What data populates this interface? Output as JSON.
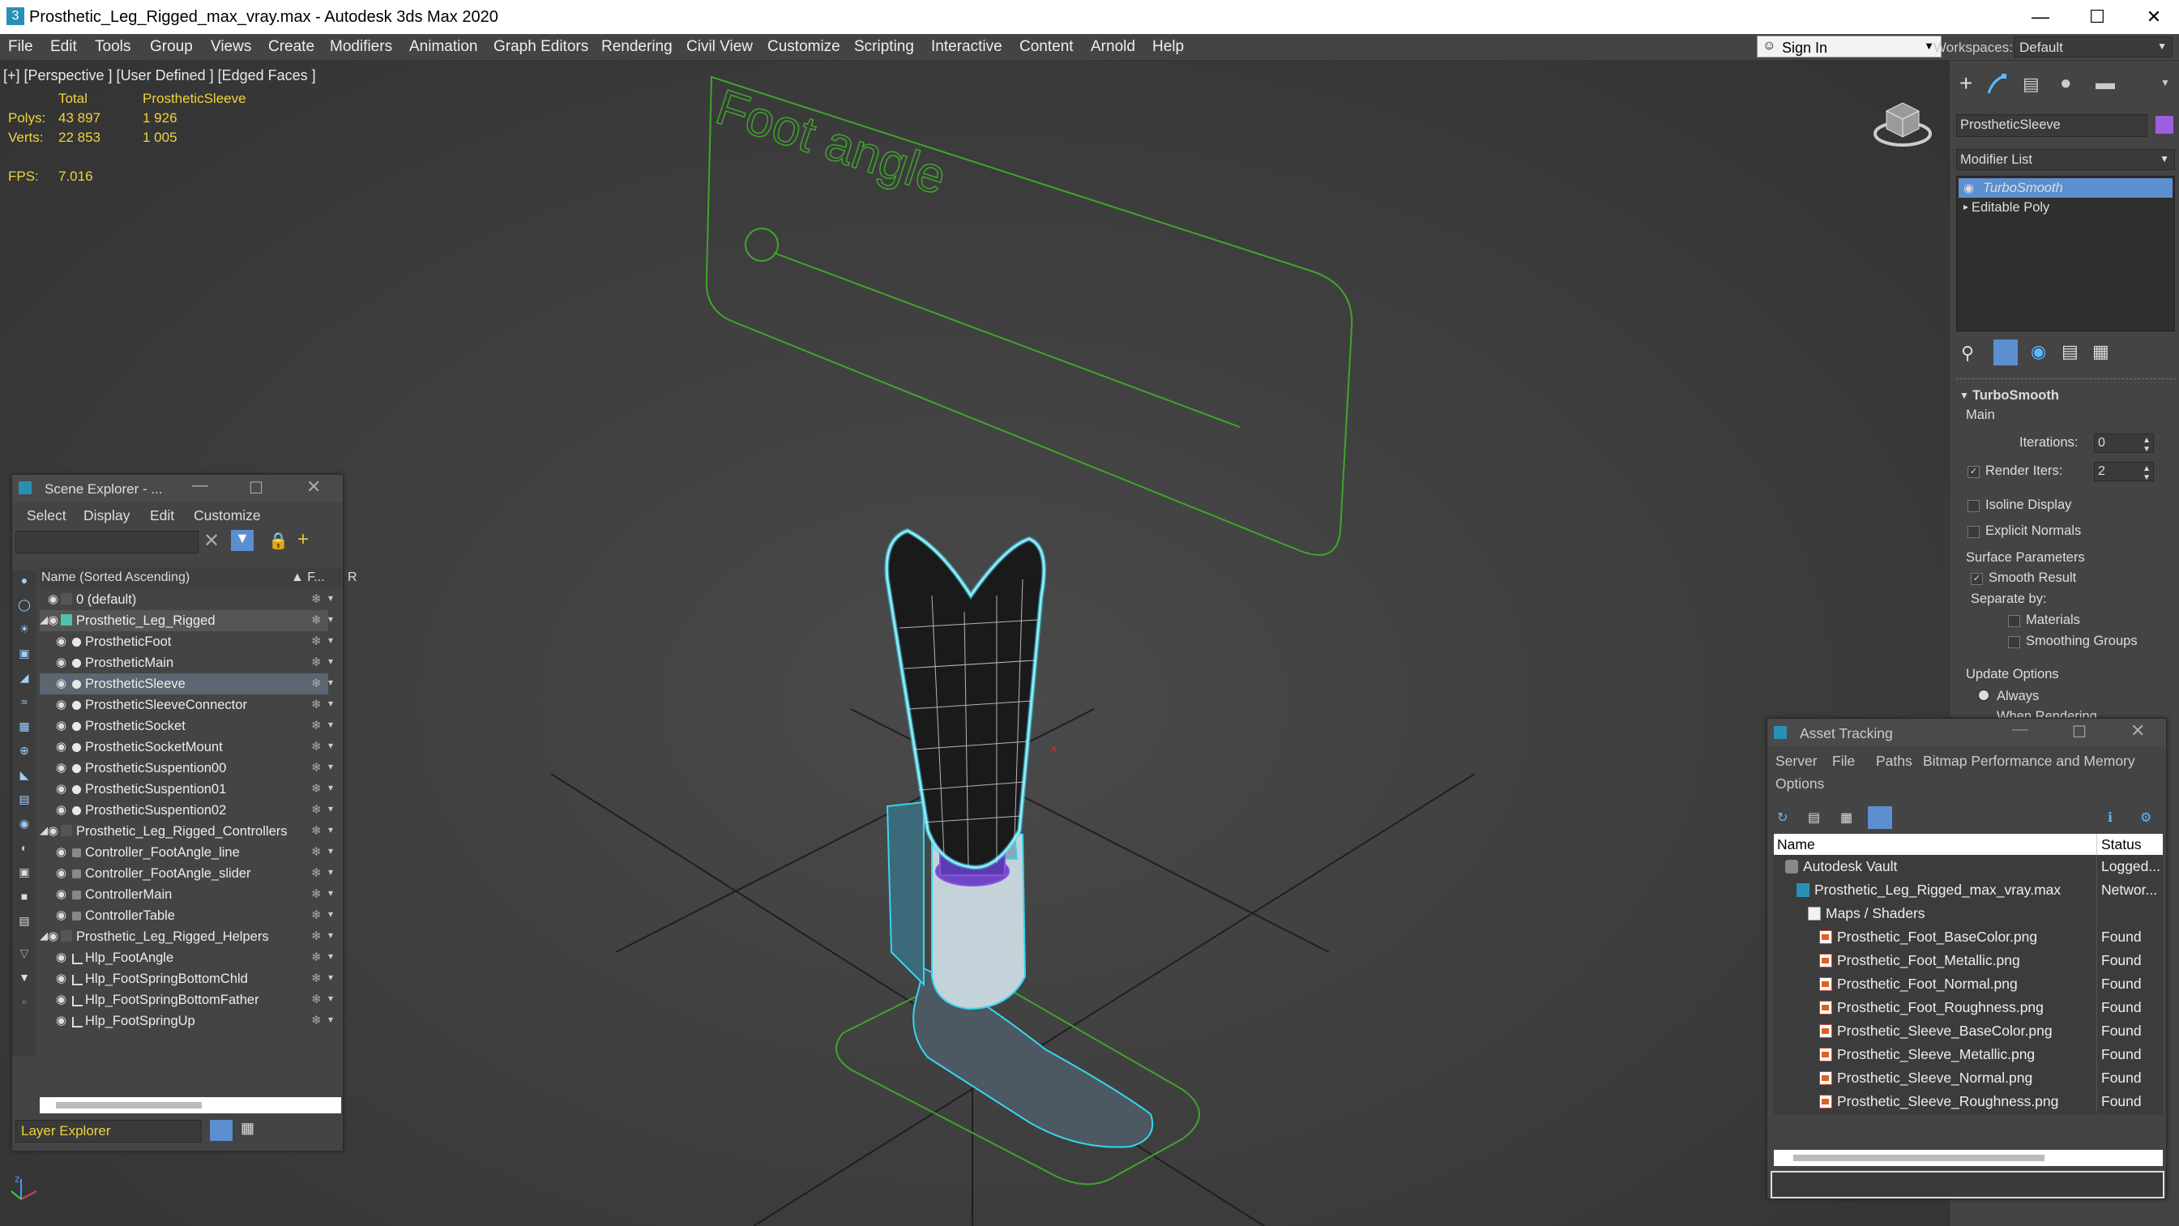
{
  "window": {
    "title": "Prosthetic_Leg_Rigged_max_vray.max - Autodesk 3ds Max 2020",
    "app_icon": "3",
    "minimize_glyph": "—",
    "maximize_glyph": "☐",
    "close_glyph": "✕"
  },
  "menubar": {
    "items": [
      "File",
      "Edit",
      "Tools",
      "Group",
      "Views",
      "Create",
      "Modifiers",
      "Animation",
      "Graph Editors",
      "Rendering",
      "Civil View",
      "Customize",
      "Scripting",
      "Interactive",
      "Content",
      "Arnold",
      "Help"
    ],
    "signin_label": "Sign In",
    "workspaces_label": "Workspaces:",
    "workspace_value": "Default"
  },
  "viewport": {
    "label": "[+] [Perspective ] [User Defined ] [Edged Faces ]",
    "stats": {
      "col_total": "Total",
      "col_object": "ProstheticSleeve",
      "polys_label": "Polys:",
      "polys_total": "43 897",
      "polys_object": "1 926",
      "verts_label": "Verts:",
      "verts_total": "22 853",
      "verts_object": "1 005",
      "fps_label": "FPS:",
      "fps_value": "7.016"
    },
    "controller_text": "Foot angle",
    "axis_x": "x",
    "axis_z": "z"
  },
  "scene_explorer": {
    "title": "Scene Explorer - ...",
    "menu": [
      "Select",
      "Display",
      "Edit",
      "Customize"
    ],
    "column_name": "Name (Sorted Ascending)",
    "column_freeze": "▲ F...",
    "column_render": "R",
    "rows": [
      {
        "label": "0 (default)",
        "indent": 0
      },
      {
        "label": "Prosthetic_Leg_Rigged",
        "indent": 0
      },
      {
        "label": "ProstheticFoot",
        "indent": 1
      },
      {
        "label": "ProstheticMain",
        "indent": 1
      },
      {
        "label": "ProstheticSleeve",
        "indent": 1
      },
      {
        "label": "ProstheticSleeveConnector",
        "indent": 1
      },
      {
        "label": "ProstheticSocket",
        "indent": 1
      },
      {
        "label": "ProstheticSocketMount",
        "indent": 1
      },
      {
        "label": "ProstheticSuspention00",
        "indent": 1
      },
      {
        "label": "ProstheticSuspention01",
        "indent": 1
      },
      {
        "label": "ProstheticSuspention02",
        "indent": 1
      },
      {
        "label": "Prosthetic_Leg_Rigged_Controllers",
        "indent": 0
      },
      {
        "label": "Controller_FootAngle_line",
        "indent": 1
      },
      {
        "label": "Controller_FootAngle_slider",
        "indent": 1
      },
      {
        "label": "ControllerMain",
        "indent": 1
      },
      {
        "label": "ControllerTable",
        "indent": 1
      },
      {
        "label": "Prosthetic_Leg_Rigged_Helpers",
        "indent": 0
      },
      {
        "label": "Hlp_FootAngle",
        "indent": 1
      },
      {
        "label": "Hlp_FootSpringBottomChld",
        "indent": 1
      },
      {
        "label": "Hlp_FootSpringBottomFather",
        "indent": 1
      },
      {
        "label": "Hlp_FootSpringUp",
        "indent": 1
      }
    ],
    "footer_label": "Layer Explorer"
  },
  "command_panel": {
    "object_name": "ProstheticSleeve",
    "object_color": "#9b5fe0",
    "modifier_list_label": "Modifier List",
    "stack": [
      "TurboSmooth",
      "Editable Poly"
    ],
    "rollout_title": "TurboSmooth",
    "main_label": "Main",
    "iterations_label": "Iterations:",
    "iterations_value": "0",
    "render_iters_label": "Render Iters:",
    "render_iters_value": "2",
    "render_iters_checked": true,
    "isoline_label": "Isoline Display",
    "explicit_normals_label": "Explicit Normals",
    "surface_params_label": "Surface Parameters",
    "smooth_result_label": "Smooth Result",
    "separate_by_label": "Separate by:",
    "materials_label": "Materials",
    "smoothing_groups_label": "Smoothing Groups",
    "update_options_label": "Update Options",
    "always_label": "Always",
    "when_rendering_label": "When Rendering"
  },
  "asset_tracking": {
    "title": "Asset Tracking",
    "menu": [
      "Server",
      "File",
      "Paths",
      "Bitmap Performance and Memory",
      "Options"
    ],
    "column_name": "Name",
    "column_status": "Status",
    "rows": [
      {
        "label": "Autodesk Vault",
        "status": "Logged...",
        "indent": 0,
        "icon": "vault-icon"
      },
      {
        "label": "Prosthetic_Leg_Rigged_max_vray.max",
        "status": "Networ...",
        "indent": 1,
        "icon": "max-file-icon"
      },
      {
        "label": "Maps / Shaders",
        "status": "",
        "indent": 2,
        "icon": "folder-icon"
      },
      {
        "label": "Prosthetic_Foot_BaseColor.png",
        "status": "Found",
        "indent": 3,
        "icon": "png-icon"
      },
      {
        "label": "Prosthetic_Foot_Metallic.png",
        "status": "Found",
        "indent": 3,
        "icon": "png-icon"
      },
      {
        "label": "Prosthetic_Foot_Normal.png",
        "status": "Found",
        "indent": 3,
        "icon": "png-icon"
      },
      {
        "label": "Prosthetic_Foot_Roughness.png",
        "status": "Found",
        "indent": 3,
        "icon": "png-icon"
      },
      {
        "label": "Prosthetic_Sleeve_BaseColor.png",
        "status": "Found",
        "indent": 3,
        "icon": "png-icon"
      },
      {
        "label": "Prosthetic_Sleeve_Metallic.png",
        "status": "Found",
        "indent": 3,
        "icon": "png-icon"
      },
      {
        "label": "Prosthetic_Sleeve_Normal.png",
        "status": "Found",
        "indent": 3,
        "icon": "png-icon"
      },
      {
        "label": "Prosthetic_Sleeve_Roughness.png",
        "status": "Found",
        "indent": 3,
        "icon": "png-icon"
      }
    ]
  },
  "colors": {
    "wire_cyan": "#36d6ef",
    "controller_green": "#3fa52c",
    "stats_yellow": "#f0d33c",
    "selection_blue": "#5b8fd0",
    "purple_connector": "#8a52e0"
  }
}
